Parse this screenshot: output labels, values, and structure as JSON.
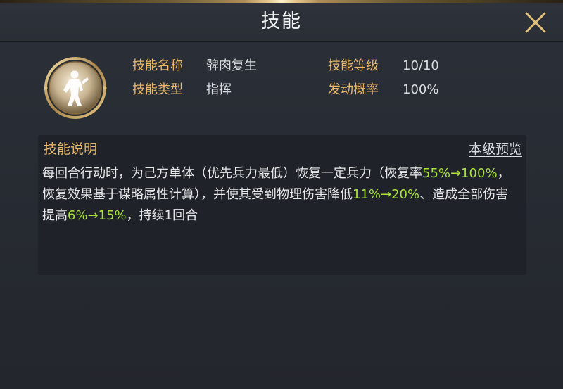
{
  "header": {
    "title": "技能"
  },
  "skill": {
    "icon": "soldier-silhouette-icon",
    "name_label": "技能名称",
    "name": "髀肉复生",
    "level_label": "技能等级",
    "level": "10/10",
    "type_label": "技能类型",
    "type": "指挥",
    "trigger_label": "发动概率",
    "trigger_rate": "100%"
  },
  "description": {
    "title": "技能说明",
    "preview_link": "本级预览",
    "segments": [
      {
        "text": "每回合行动时，为己方单体（优先兵力最低）恢复一定兵力（恢复率",
        "highlight": false
      },
      {
        "text": "55%→100%",
        "highlight": true
      },
      {
        "text": "，恢复效果基于谋略属性计算），并使其受到物理伤害降低",
        "highlight": false
      },
      {
        "text": "11%→20%",
        "highlight": true
      },
      {
        "text": "、造成全部伤害提高",
        "highlight": false
      },
      {
        "text": "6%→15%",
        "highlight": true
      },
      {
        "text": "，持续1回合",
        "highlight": false
      }
    ]
  },
  "colors": {
    "label_gold": "#e9b86a",
    "highlight_green": "#a8e23a",
    "value_text": "#d9dce0"
  }
}
